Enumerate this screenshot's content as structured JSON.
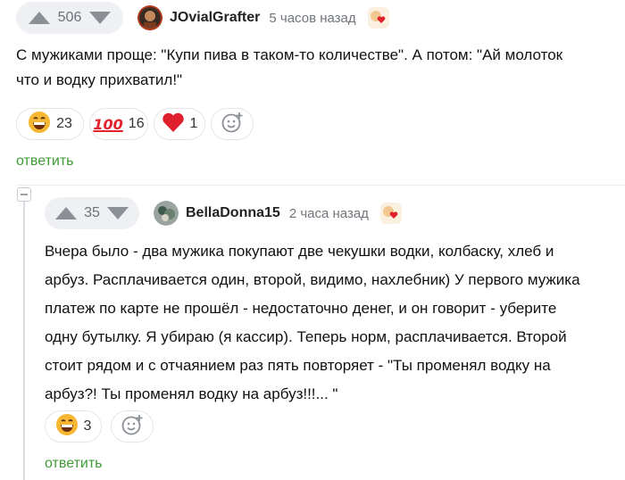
{
  "comment1": {
    "votes": "506",
    "username": "JOvialGrafter",
    "time": "5 часов назад",
    "text_line1": "С мужиками проще: \"Купи пива в таком-то количестве\". А потом: \"Ай молоток",
    "text_line2": "что и водку прихватил!\"",
    "reactions": [
      {
        "icon": "grinning-face-icon",
        "count": "23"
      },
      {
        "icon": "hundred-points-icon",
        "count": "16",
        "glyph": "100"
      },
      {
        "icon": "red-heart-icon",
        "count": "1"
      }
    ],
    "reply_label": "ответить"
  },
  "comment2": {
    "votes": "35",
    "username": "BellaDonna15",
    "time": "2 часа назад",
    "text_lines": [
      "Вчера было - два мужика покупают две чекушки водки, колбаску, хлеб и",
      "арбуз. Расплачивается один, второй, видимо, нахлебник) У первого мужика",
      "платеж по карте не прошёл - недостаточно денег, и он говорит - уберите",
      "одну бутылку. Я убираю (я кассир). Теперь норм, расплачивается. Второй",
      "стоит рядом и с отчаянием раз пять повторяет - \"Ты променял водку на",
      "арбуз?! Ты променял водку на арбуз!!!... \""
    ],
    "reactions": [
      {
        "icon": "grinning-face-icon",
        "count": "3"
      }
    ],
    "reply_label": "ответить"
  },
  "colors": {
    "accent_green": "#3e9b34",
    "heart_red": "#e0202c",
    "hundred_red": "#e3212d",
    "emoji_yellow": "#f7b733"
  }
}
